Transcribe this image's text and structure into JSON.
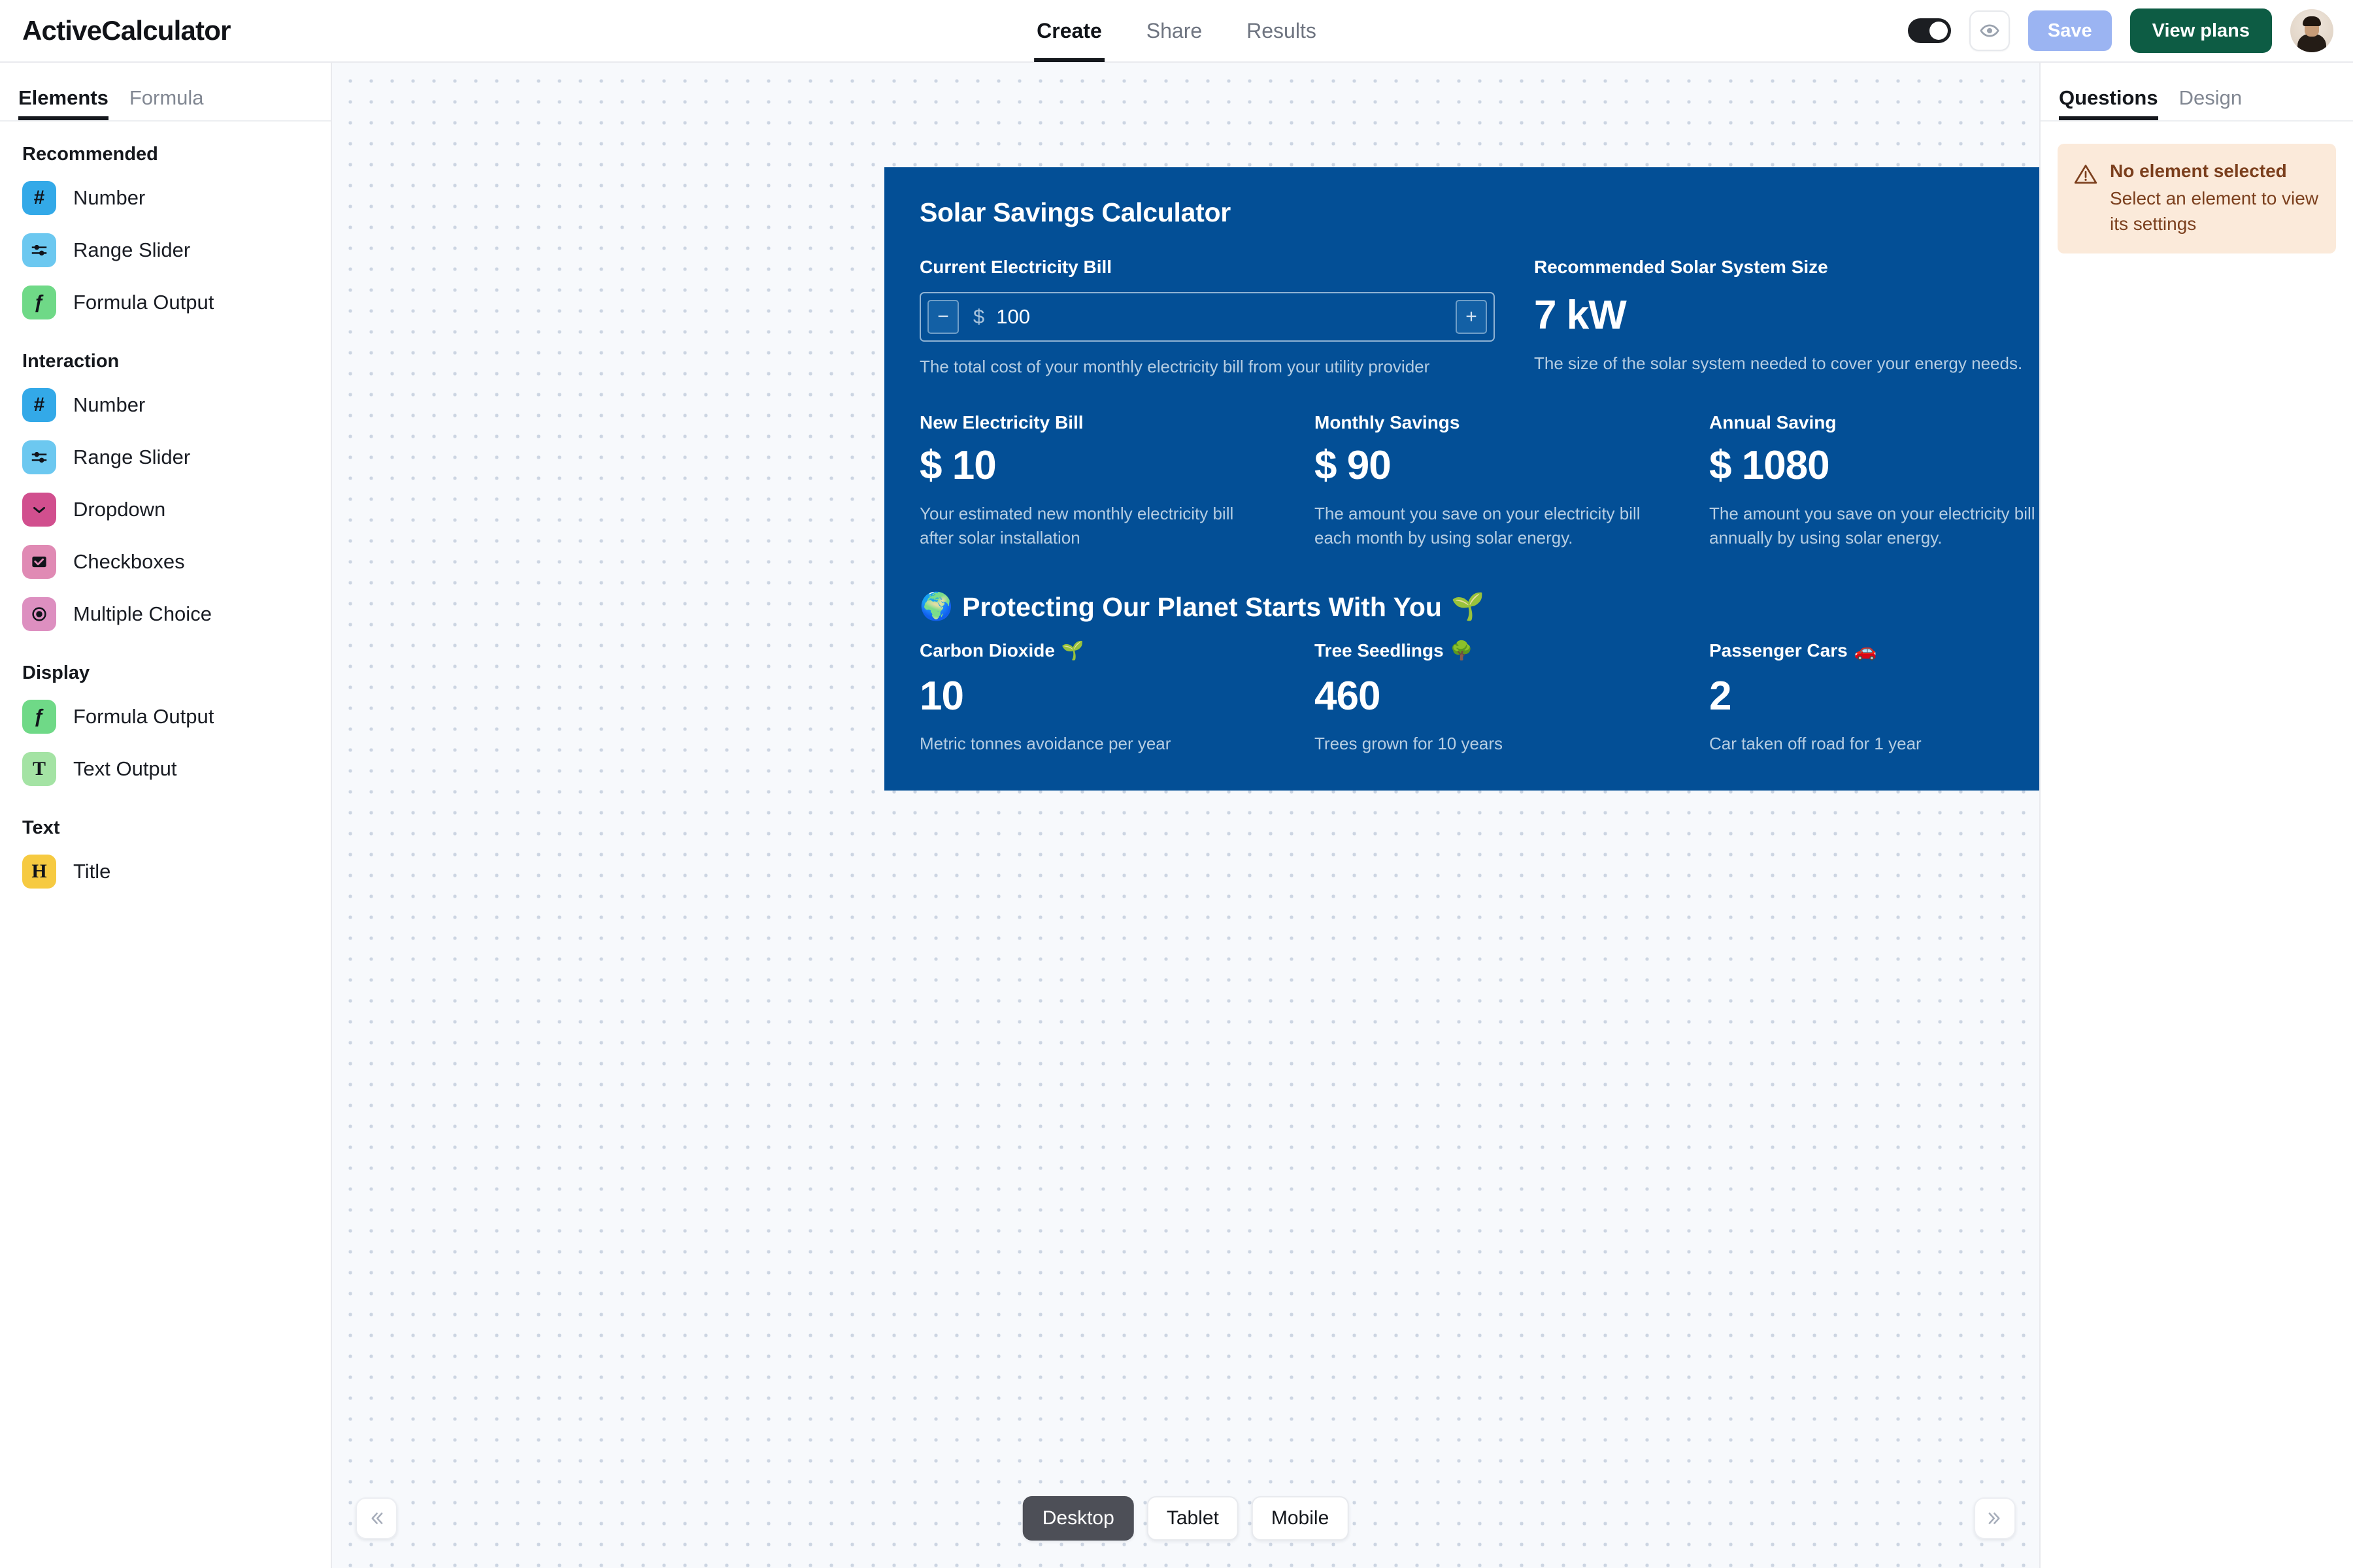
{
  "header": {
    "logo": "ActiveCalculator",
    "nav": [
      {
        "label": "Create",
        "active": true
      },
      {
        "label": "Share",
        "active": false
      },
      {
        "label": "Results",
        "active": false
      }
    ],
    "preview_toggle_state": "on",
    "preview_icon": "eye-icon",
    "save_label": "Save",
    "plans_label": "View plans",
    "avatar": "user-avatar"
  },
  "sidebar": {
    "tabs": [
      {
        "label": "Elements",
        "active": true
      },
      {
        "label": "Formula",
        "active": false
      }
    ],
    "groups": [
      {
        "title": "Recommended",
        "items": [
          {
            "label": "Number",
            "icon": "hash-icon",
            "glyph": "#",
            "color": "#33a9e8"
          },
          {
            "label": "Range Slider",
            "icon": "sliders-icon",
            "glyph": "",
            "color": "#6cc8f0"
          },
          {
            "label": "Formula Output",
            "icon": "function-icon",
            "glyph": "ƒ",
            "color": "#6fd987"
          }
        ]
      },
      {
        "title": "Interaction",
        "items": [
          {
            "label": "Number",
            "icon": "hash-icon",
            "glyph": "#",
            "color": "#33a9e8"
          },
          {
            "label": "Range Slider",
            "icon": "sliders-icon",
            "glyph": "",
            "color": "#6cc8f0"
          },
          {
            "label": "Dropdown",
            "icon": "chevron-down-icon",
            "glyph": "",
            "color": "#d14f8e"
          },
          {
            "label": "Checkboxes",
            "icon": "checkbox-icon",
            "glyph": "",
            "color": "#e08ab4"
          },
          {
            "label": "Multiple Choice",
            "icon": "radio-icon",
            "glyph": "",
            "color": "#dd8fc0"
          }
        ]
      },
      {
        "title": "Display",
        "items": [
          {
            "label": "Formula Output",
            "icon": "function-icon",
            "glyph": "ƒ",
            "color": "#6fd987"
          },
          {
            "label": "Text Output",
            "icon": "text-icon",
            "glyph": "T",
            "color": "#a4e3a4"
          }
        ]
      },
      {
        "title": "Text",
        "items": [
          {
            "label": "Title",
            "icon": "heading-icon",
            "glyph": "H",
            "color": "#f6ca41"
          }
        ]
      }
    ]
  },
  "calculator": {
    "title": "Solar Savings Calculator",
    "background_color": "#034f96",
    "input": {
      "label": "Current Electricity Bill",
      "currency": "$",
      "value": "100",
      "decrement": "−",
      "increment": "+",
      "helper": "The total cost of your monthly electricity bill from your utility provider"
    },
    "system_size": {
      "label": "Recommended Solar System Size",
      "value": "7 kW",
      "helper": "The size of the solar system needed to cover your energy needs."
    },
    "metrics": [
      {
        "label": "New Electricity Bill",
        "value": "$ 10",
        "desc": "Your estimated new monthly electricity bill after solar installation"
      },
      {
        "label": "Monthly Savings",
        "value": "$ 90",
        "desc": "The amount you save on your electricity bill each month by using solar energy."
      },
      {
        "label": "Annual Saving",
        "value": "$ 1080",
        "desc": "The amount you save on your electricity bill annually by using solar energy."
      }
    ],
    "eco_heading_prefix": "🌍",
    "eco_heading": "Protecting Our Planet Starts With You",
    "eco_heading_suffix": "🌱",
    "eco": [
      {
        "label": "Carbon Dioxide",
        "emoji": "🌱",
        "value": "10",
        "desc": "Metric tonnes avoidance per year"
      },
      {
        "label": "Tree Seedlings",
        "emoji": "🌳",
        "value": "460",
        "desc": "Trees grown for 10 years"
      },
      {
        "label": "Passenger Cars",
        "emoji": "🚗",
        "value": "2",
        "desc": "Car taken off road for 1 year"
      }
    ]
  },
  "bottom": {
    "collapse_left": "«",
    "collapse_right": "»",
    "devices": [
      {
        "label": "Desktop",
        "active": true
      },
      {
        "label": "Tablet",
        "active": false
      },
      {
        "label": "Mobile",
        "active": false
      }
    ]
  },
  "right_panel": {
    "tabs": [
      {
        "label": "Questions",
        "active": true
      },
      {
        "label": "Design",
        "active": false
      }
    ],
    "alert": {
      "icon": "warning-triangle-icon",
      "title": "No element selected",
      "text": "Select an element to view its settings"
    }
  }
}
